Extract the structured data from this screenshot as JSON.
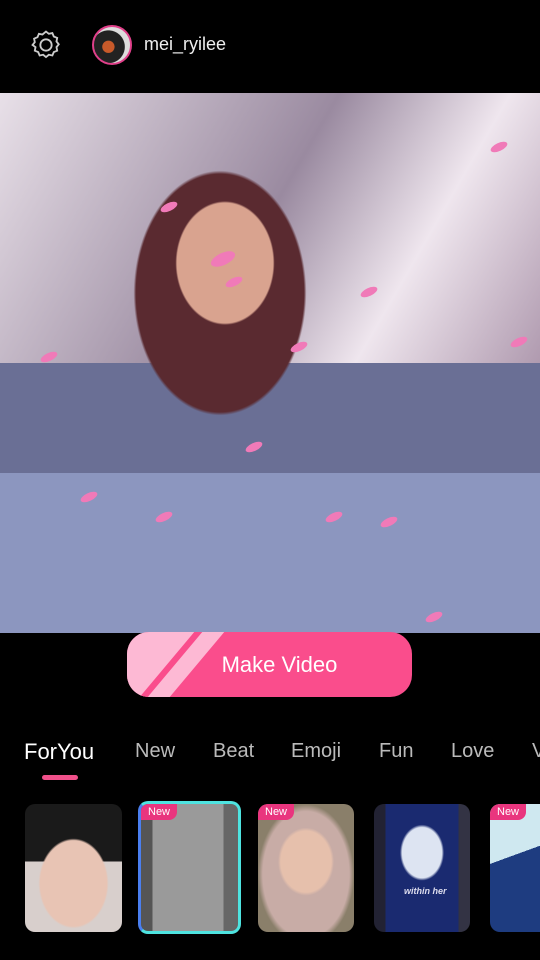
{
  "header": {
    "settings_icon": "gear-icon",
    "username": "mei_ryilee"
  },
  "main": {
    "make_video_label": "Make Video"
  },
  "tabs": [
    {
      "label": "ForYou",
      "active": true
    },
    {
      "label": "New"
    },
    {
      "label": "Beat"
    },
    {
      "label": "Emoji"
    },
    {
      "label": "Fun"
    },
    {
      "label": "Love"
    },
    {
      "label": "V"
    }
  ],
  "templates": [
    {
      "badge": ""
    },
    {
      "badge": "New",
      "selected": true
    },
    {
      "badge": "New"
    },
    {
      "badge": "",
      "caption": "within her"
    },
    {
      "badge": "New"
    }
  ],
  "colors": {
    "accent": "#fa4d8c",
    "selected_border": "#4ee3e0"
  }
}
